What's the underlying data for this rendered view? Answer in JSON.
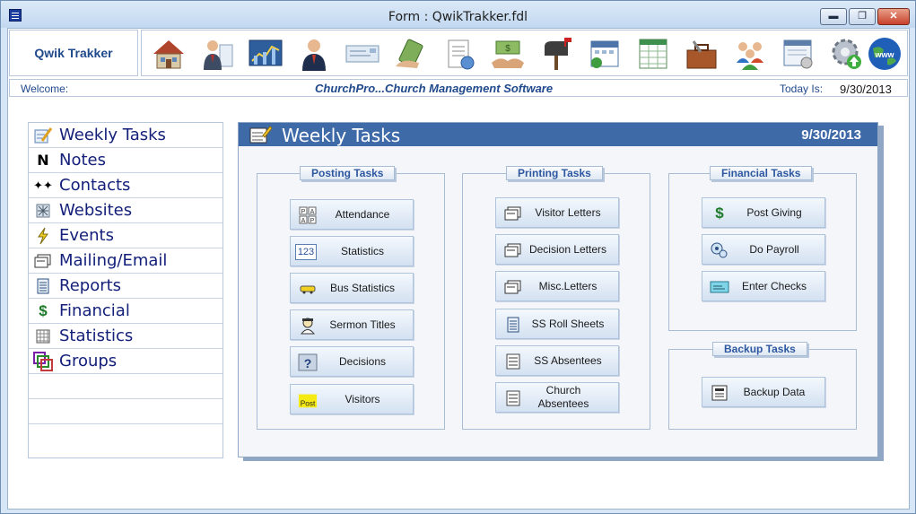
{
  "window": {
    "title": "Form : QwikTrakker.fdl",
    "min_glyph": "▬",
    "max_glyph": "❐",
    "close_glyph": "✕"
  },
  "header": {
    "app_name": "Qwik Trakker",
    "toolbar_icons": [
      "house-icon",
      "manager-icon",
      "chart-icon",
      "person-icon",
      "check-icon",
      "money-hand-icon",
      "clipboard-icon",
      "cash-handshake-icon",
      "mailbox-icon",
      "calendar-icon",
      "spreadsheet-icon",
      "toolbox-icon",
      "people-icon",
      "settings-window-icon",
      "gear-upload-icon",
      "www-globe-icon"
    ]
  },
  "welcome_bar": {
    "welcome_label": "Welcome:",
    "tagline": "ChurchPro...Church Management Software",
    "today_label": "Today Is:",
    "today_value": "9/30/2013"
  },
  "sidebar": {
    "items": [
      {
        "label": "Weekly Tasks",
        "icon": "checklist-pencil-icon"
      },
      {
        "label": "Notes",
        "icon": "notes-icon"
      },
      {
        "label": "Contacts",
        "icon": "contacts-icon"
      },
      {
        "label": "Websites",
        "icon": "websites-icon"
      },
      {
        "label": "Events",
        "icon": "lightning-icon"
      },
      {
        "label": "Mailing/Email",
        "icon": "mail-icon"
      },
      {
        "label": "Reports",
        "icon": "report-icon"
      },
      {
        "label": "Financial",
        "icon": "dollar-icon"
      },
      {
        "label": "Statistics",
        "icon": "statistics-icon"
      },
      {
        "label": "Groups",
        "icon": "groups-icon"
      }
    ]
  },
  "panel": {
    "title": "Weekly Tasks",
    "date": "9/30/2013",
    "groups": {
      "posting": {
        "title": "Posting Tasks",
        "buttons": [
          "Attendance",
          "Statistics",
          "Bus Statistics",
          "Sermon Titles",
          "Decisions",
          "Visitors"
        ]
      },
      "printing": {
        "title": "Printing Tasks",
        "buttons": [
          "Visitor Letters",
          "Decision Letters",
          "Misc.Letters",
          "SS Roll Sheets",
          "SS Absentees",
          "Church Absentees"
        ]
      },
      "financial": {
        "title": "Financial Tasks",
        "buttons": [
          "Post Giving",
          "Do Payroll",
          "Enter Checks"
        ]
      },
      "backup": {
        "title": "Backup Tasks",
        "buttons": [
          "Backup Data"
        ]
      }
    },
    "icon_text": {
      "attendance": [
        "P",
        "A",
        "A",
        "P"
      ],
      "statistics": "123",
      "post": "Post"
    }
  },
  "colors": {
    "accent": "#3f6aa8",
    "label_blue": "#214a8c",
    "sidebar_text": "#14207a"
  }
}
